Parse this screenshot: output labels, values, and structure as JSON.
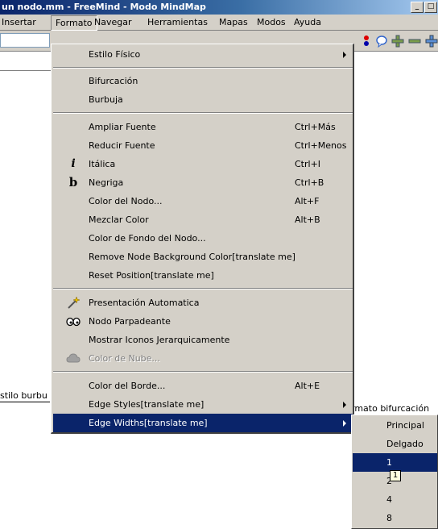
{
  "window": {
    "title": "un nodo.mm - FreeMind - Modo MindMap",
    "minimize_glyph": "_",
    "maximize_glyph": "□"
  },
  "menubar": {
    "items": [
      {
        "label": "Insertar"
      },
      {
        "label": "Formato"
      },
      {
        "label": "Navegar"
      },
      {
        "label": "Herramientas"
      },
      {
        "label": "Mapas"
      },
      {
        "label": "Modos"
      },
      {
        "label": "Ayuda"
      }
    ]
  },
  "toolbar": {
    "icons": [
      "folded-flag-icon",
      "bubble-icon",
      "plus-icon",
      "minus-icon",
      "plus-icon"
    ]
  },
  "canvas": {
    "left_node_text": "stilo burbu",
    "right_node_text": "rmato bifurcación"
  },
  "format_menu": {
    "items": [
      {
        "label": "Estilo Físico",
        "accelerator": "",
        "submenu": true
      },
      {
        "label": "Bifurcación",
        "accelerator": ""
      },
      {
        "label": "Burbuja",
        "accelerator": ""
      },
      {
        "label": "Ampliar Fuente",
        "accelerator": "Ctrl+Más"
      },
      {
        "label": "Reducir Fuente",
        "accelerator": "Ctrl+Menos"
      },
      {
        "label": "Itálica",
        "accelerator": "Ctrl+I",
        "icon": "italic-icon",
        "icon_glyph": "i"
      },
      {
        "label": "Negriga",
        "accelerator": "Ctrl+B",
        "icon": "bold-icon",
        "icon_glyph": "b"
      },
      {
        "label": "Color del Nodo...",
        "accelerator": "Alt+F"
      },
      {
        "label": "Mezclar Color",
        "accelerator": "Alt+B"
      },
      {
        "label": "Color de Fondo del Nodo...",
        "accelerator": ""
      },
      {
        "label": "Remove Node Background Color[translate me]",
        "accelerator": ""
      },
      {
        "label": "Reset Position[translate me]",
        "accelerator": ""
      },
      {
        "label": "Presentación Automatica",
        "accelerator": "",
        "icon": "magic-wand-icon"
      },
      {
        "label": "Nodo Parpadeante",
        "accelerator": "",
        "icon": "eyes-icon"
      },
      {
        "label": "Mostrar Iconos Jerarquicamente",
        "accelerator": ""
      },
      {
        "label": "Color de Nube...",
        "accelerator": "",
        "icon": "cloud-icon",
        "disabled": true
      },
      {
        "label": "Color del Borde...",
        "accelerator": "Alt+E"
      },
      {
        "label": "Edge Styles[translate me]",
        "accelerator": "",
        "submenu": true
      },
      {
        "label": "Edge Widths[translate me]",
        "accelerator": "",
        "submenu": true,
        "highlighted": true
      }
    ]
  },
  "edge_widths_submenu": {
    "items": [
      {
        "label": "Principal"
      },
      {
        "label": "Delgado"
      },
      {
        "label": "1",
        "highlighted": true
      },
      {
        "label": "2"
      },
      {
        "label": "4"
      },
      {
        "label": "8"
      }
    ]
  },
  "tooltip": {
    "text": "1"
  },
  "colors": {
    "highlight": "#0a246a",
    "menu_bg": "#d4d0c8",
    "titlebar": "#0a246a"
  }
}
